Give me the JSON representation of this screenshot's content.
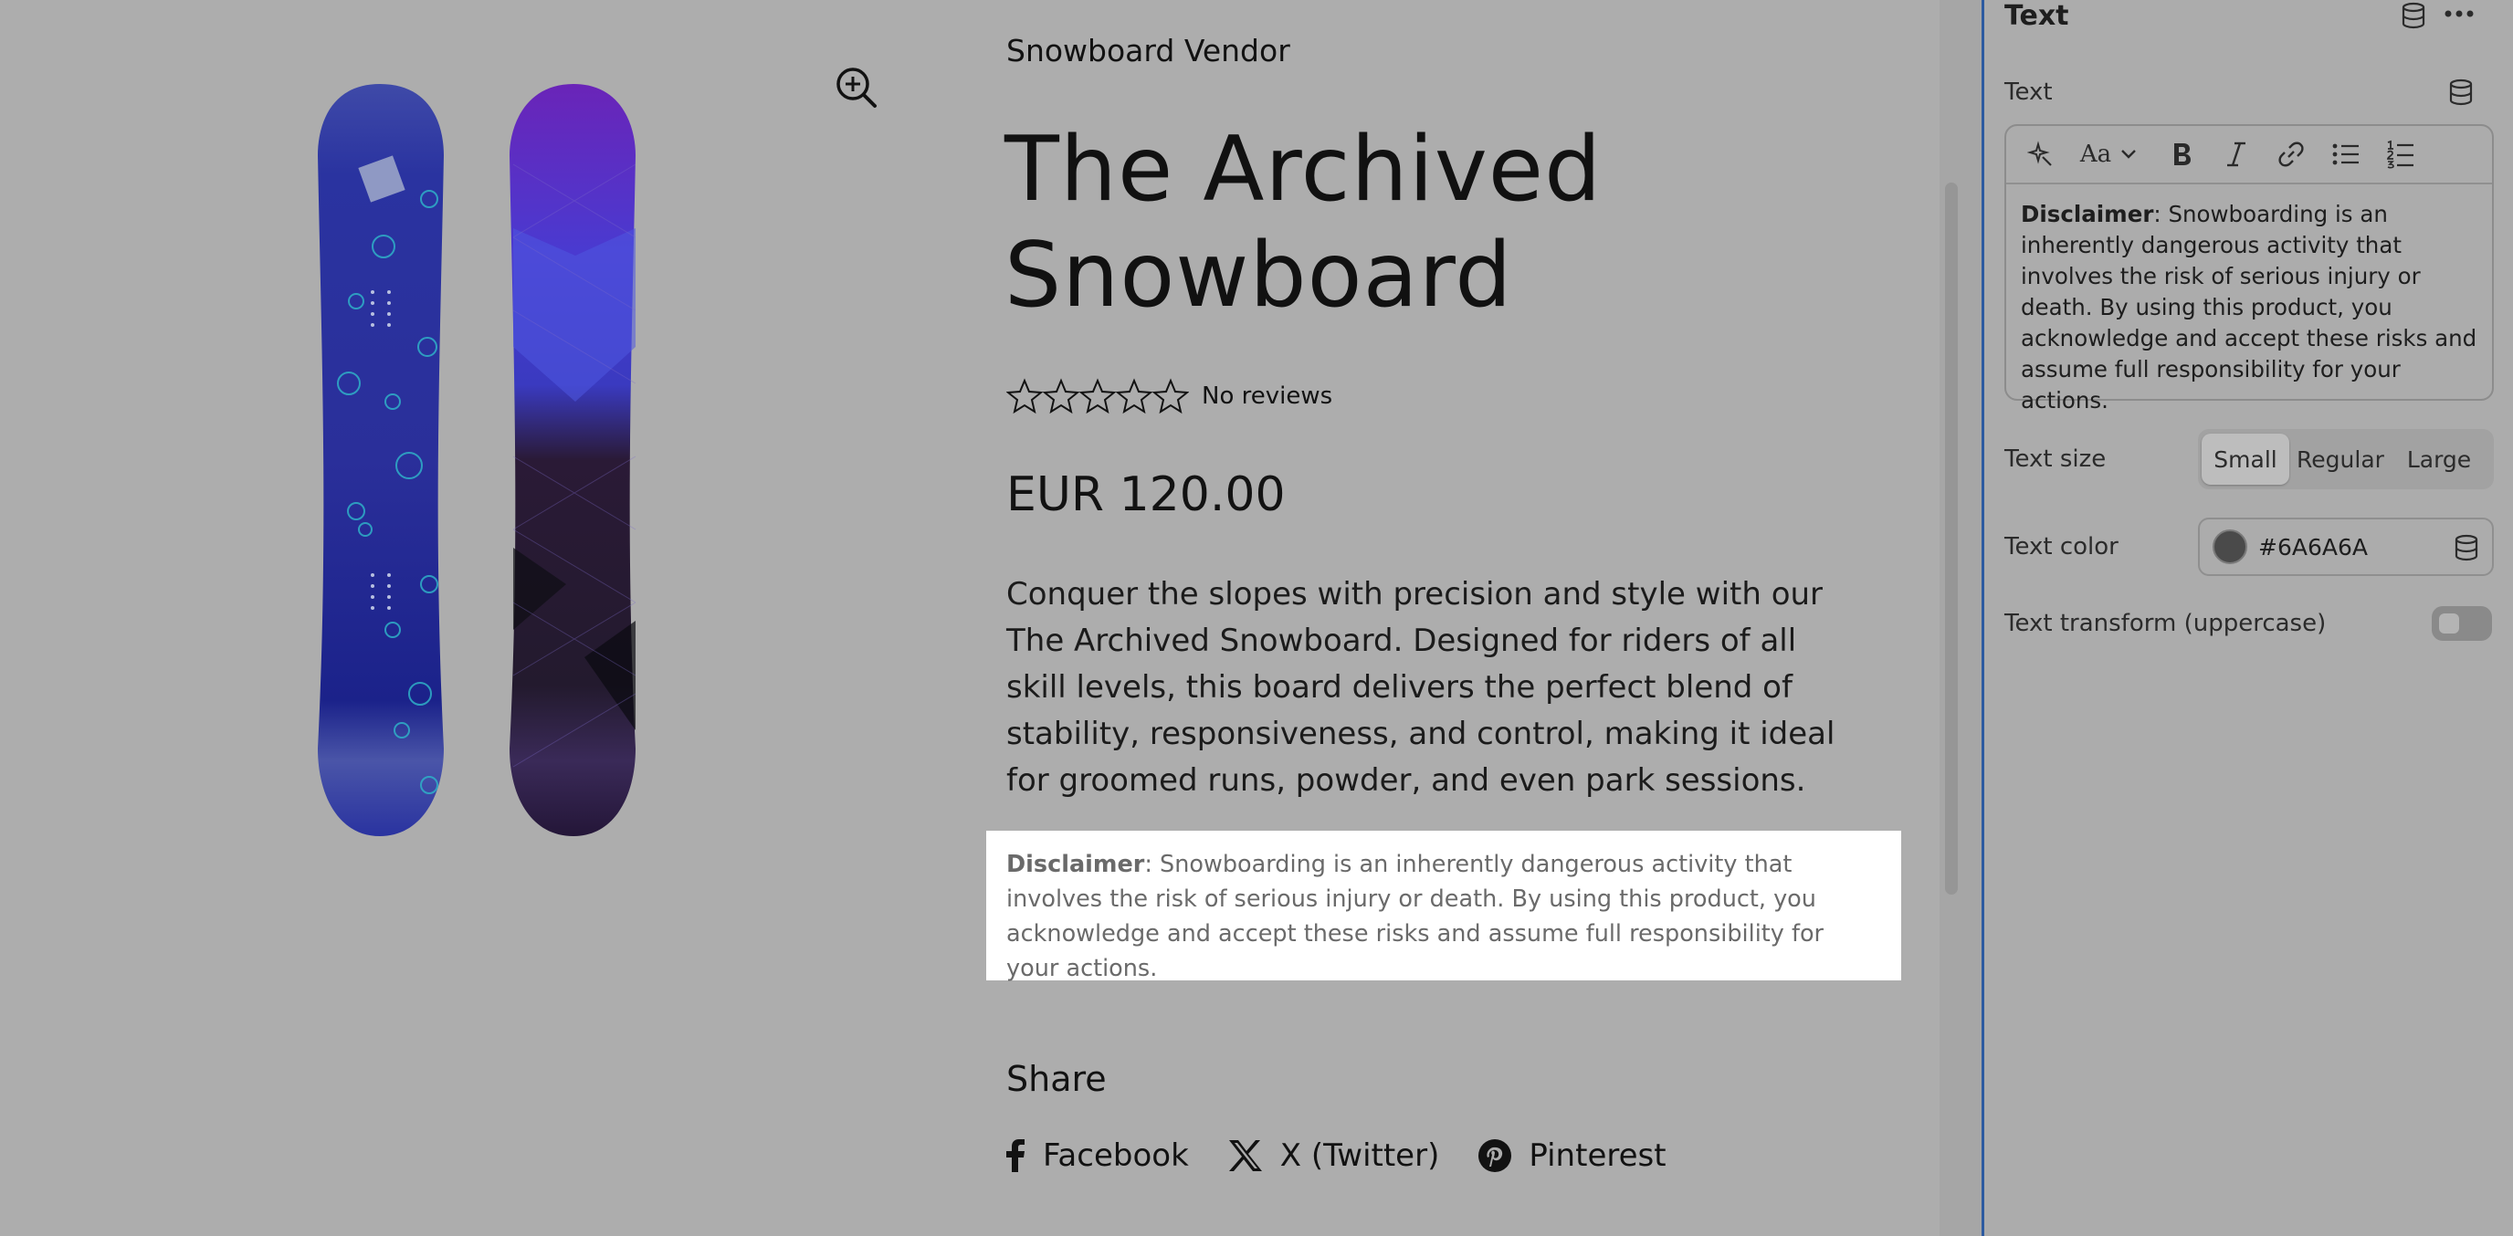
{
  "product": {
    "vendor": "Snowboard Vendor",
    "title_line1": "The Archived",
    "title_line2": "Snowboard",
    "reviews_text": "No reviews",
    "rating_stars": 0,
    "rating_max": 5,
    "price": "EUR 120.00",
    "description": "Conquer the slopes with precision and style with our The Archived Snowboard. Designed for riders of all skill levels, this board delivers the perfect blend of stability, responsiveness, and control, making it ideal for groomed runs, powder, and even park sessions.",
    "disclaimer_label": "Disclaimer",
    "disclaimer_body": ": Snowboarding is an inherently dangerous activity that involves the risk of serious injury or death. By using this product, you acknowledge and accept these risks and assume full responsibility for your actions."
  },
  "share": {
    "title": "Share",
    "links": [
      {
        "label": "Facebook",
        "icon": "facebook-icon"
      },
      {
        "label": "X (Twitter)",
        "icon": "x-twitter-icon"
      },
      {
        "label": "Pinterest",
        "icon": "pinterest-icon"
      }
    ]
  },
  "panel": {
    "title": "Text",
    "field_label": "Text",
    "editor": {
      "font_button_label": "Aa",
      "content_label": "Disclaimer",
      "content_body": ": Snowboarding is an inherently dangerous activity that involves the risk of serious injury or death. By using this product, you acknowledge and accept these risks and assume full responsibility for your actions.",
      "toolbar_icons": [
        "magic-icon",
        "font-icon",
        "bold-icon",
        "italic-icon",
        "link-icon",
        "bullet-list-icon",
        "numbered-list-icon"
      ]
    },
    "text_size": {
      "label": "Text size",
      "options": [
        "Small",
        "Regular",
        "Large"
      ],
      "selected": "Small"
    },
    "text_color": {
      "label": "Text color",
      "value": "#6A6A6A",
      "swatch": "#4a4a4a"
    },
    "text_transform": {
      "label": "Text transform (uppercase)",
      "enabled": false
    }
  },
  "colors": {
    "accent": "#2c5aa0",
    "disclaimer_text": "#6a6a6a",
    "board1": "#1f2a8f",
    "board2": "#5a1fa0"
  }
}
